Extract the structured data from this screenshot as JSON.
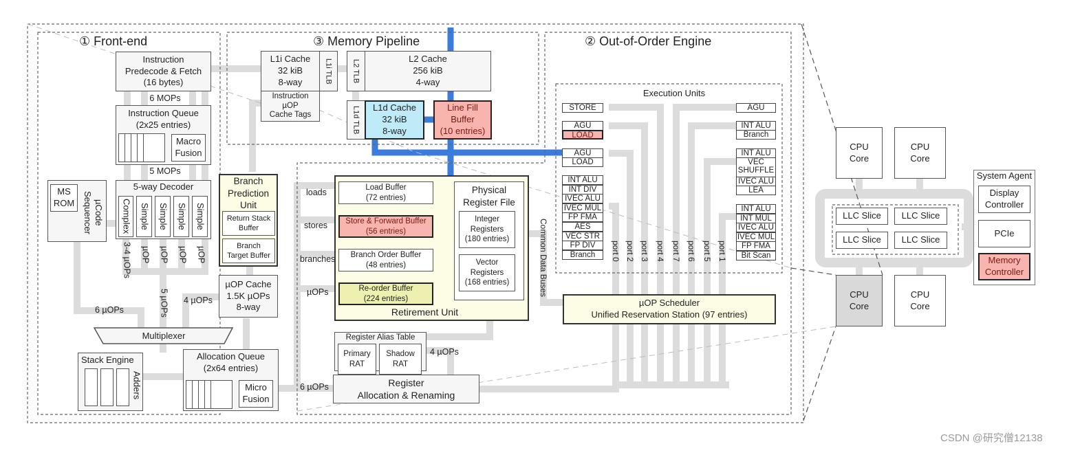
{
  "sections": {
    "front_end": "① Front-end",
    "memory_pipeline": "③ Memory Pipeline",
    "ooo_engine": "② Out-of-Order Engine"
  },
  "front_end": {
    "predecode": "Instruction\nPredecode & Fetch\n(16 bytes)",
    "mops6": "6 MOPs",
    "iq": "Instruction Queue\n(2x25 entries)",
    "macro_fusion": "Macro\nFusion",
    "mops5": "5 MOPs",
    "decoder": "5-way Decoder",
    "decoders": [
      "Complex",
      "Simple",
      "Simple",
      "Simple",
      "Simple"
    ],
    "ms_rom": "MS\nROM",
    "ucode_seq": "µCode\nSequencer",
    "bpu": "Branch\nPrediction\nUnit",
    "rsb": "Return Stack\nBuffer",
    "btb": "Branch\nTarget Buffer",
    "dec_outputs": [
      "3-4 µOPs",
      "µOP",
      "µOP",
      "µOP",
      "µOP"
    ],
    "uop_cache": "µOP Cache\n1.5K µOPs\n8-way",
    "uops6": "6 µOPs",
    "uops5": "5 µOPs",
    "uops4": "4 µOPs",
    "mux": "Multiplexer",
    "stack_engine": "Stack Engine",
    "adders": "Adders",
    "alloc_queue": "Allocation Queue\n(2x64 entries)",
    "micro_fusion": "Micro\nFusion"
  },
  "memory": {
    "l1i": "L1i Cache\n32 kiB\n8-way",
    "l1i_tlb": "L1i TLB",
    "uop_tags": "Instruction\nµOP\nCache Tags",
    "l2_tlb": "L2 TLB",
    "l2": "L2 Cache\n256 kiB\n4-way",
    "l1d_tlb": "L1d TLB",
    "l1d": "L1d Cache\n32 kiB\n8-way",
    "lfb": "Line Fill\nBuffer\n(10 entries)"
  },
  "ooo": {
    "exec_title": "Execution Units",
    "left_units": {
      "store": "STORE",
      "g1": [
        "AGU",
        "LOAD"
      ],
      "g2": [
        "AGU",
        "LOAD"
      ],
      "g3": [
        "INT ALU",
        "INT DIV",
        "IVEC ALU",
        "IVEC MUL",
        "FP FMA",
        "AES",
        "VEC STR",
        "FP DIV",
        "Branch"
      ]
    },
    "right_units": {
      "agu": "AGU",
      "g1": [
        "INT ALU",
        "Branch"
      ],
      "g2": [
        "INT ALU",
        "VEC\nSHUFFLE",
        "IVEC ALU",
        "LEA"
      ],
      "g3": [
        "INT ALU",
        "INT MUL",
        "IVEC ALU",
        "IVEC MUL",
        "FP FMA",
        "Bit Scan"
      ]
    },
    "ports": [
      "port 0",
      "port 2",
      "port 3",
      "port 4",
      "port 7",
      "port 6",
      "port 5",
      "port 1"
    ],
    "cdb": "Common Data Buses",
    "scheduler": "µOP Scheduler\nUnified Reservation Station (97 entries)",
    "lanes": {
      "loads": "loads",
      "stores": "stores",
      "branches": "branches",
      "uops": "µOPs",
      "uops6": "6 µOPs",
      "uops4": "4 µOPs"
    },
    "load_buf": "Load Buffer\n(72 entries)",
    "sfb": "Store & Forward Buffer\n(56 entries)",
    "bob": "Branch Order Buffer\n(48 entries)",
    "rob": "Re-order Buffer\n(224 entries)",
    "retire": "Retirement Unit",
    "prf": "Physical\nRegister File",
    "int_regs": "Integer\nRegisters\n(180 entries)",
    "vec_regs": "Vector\nRegisters\n(168 entries)",
    "rat": "Register Alias Table",
    "primary_rat": "Primary\nRAT",
    "shadow_rat": "Shadow\nRAT",
    "rename": "Register\nAllocation & Renaming"
  },
  "chip": {
    "cores": [
      "CPU\nCore",
      "CPU\nCore",
      "CPU\nCore",
      "CPU\nCore"
    ],
    "llc": [
      "LLC Slice",
      "LLC Slice",
      "LLC Slice",
      "LLC Slice"
    ],
    "system_agent": "System Agent",
    "display": "Display\nController",
    "pcie": "PCIe",
    "memctrl": "Memory\nController"
  },
  "colors": {
    "highlight_pink": "#f8b4ae",
    "l1d_cyan": "#bfeaf7",
    "data_path_blue": "#3b7bdc",
    "connector_gray": "#dcdcdc",
    "retire_yellow": "#fdfde6",
    "selected_core": "#d9d9d9"
  },
  "watermark": "CSDN @研究僧12138"
}
